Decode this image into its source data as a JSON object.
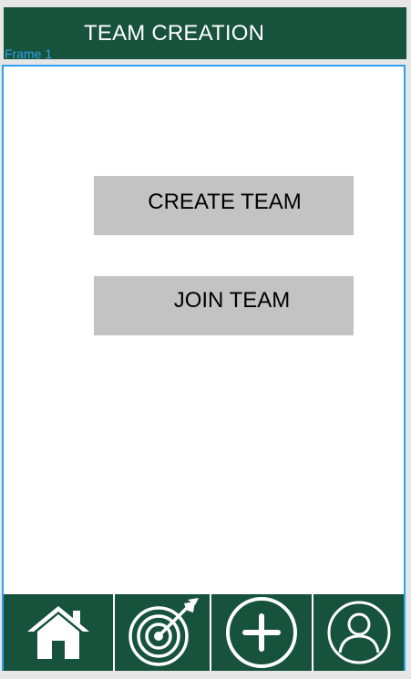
{
  "header": {
    "title": "TEAM CREATION"
  },
  "frame": {
    "label": "Frame 1"
  },
  "main": {
    "create_team_label": "CREATE TEAM",
    "join_team_label": "JOIN TEAM"
  },
  "bottom_nav": {
    "items": [
      {
        "icon": "home-icon"
      },
      {
        "icon": "target-icon"
      },
      {
        "icon": "add-icon"
      },
      {
        "icon": "profile-icon"
      }
    ]
  },
  "colors": {
    "header_bg": "#17523c",
    "frame_border": "#2ea1ee",
    "button_bg": "#c3c3c3",
    "page_bg": "#e6e6e6"
  }
}
